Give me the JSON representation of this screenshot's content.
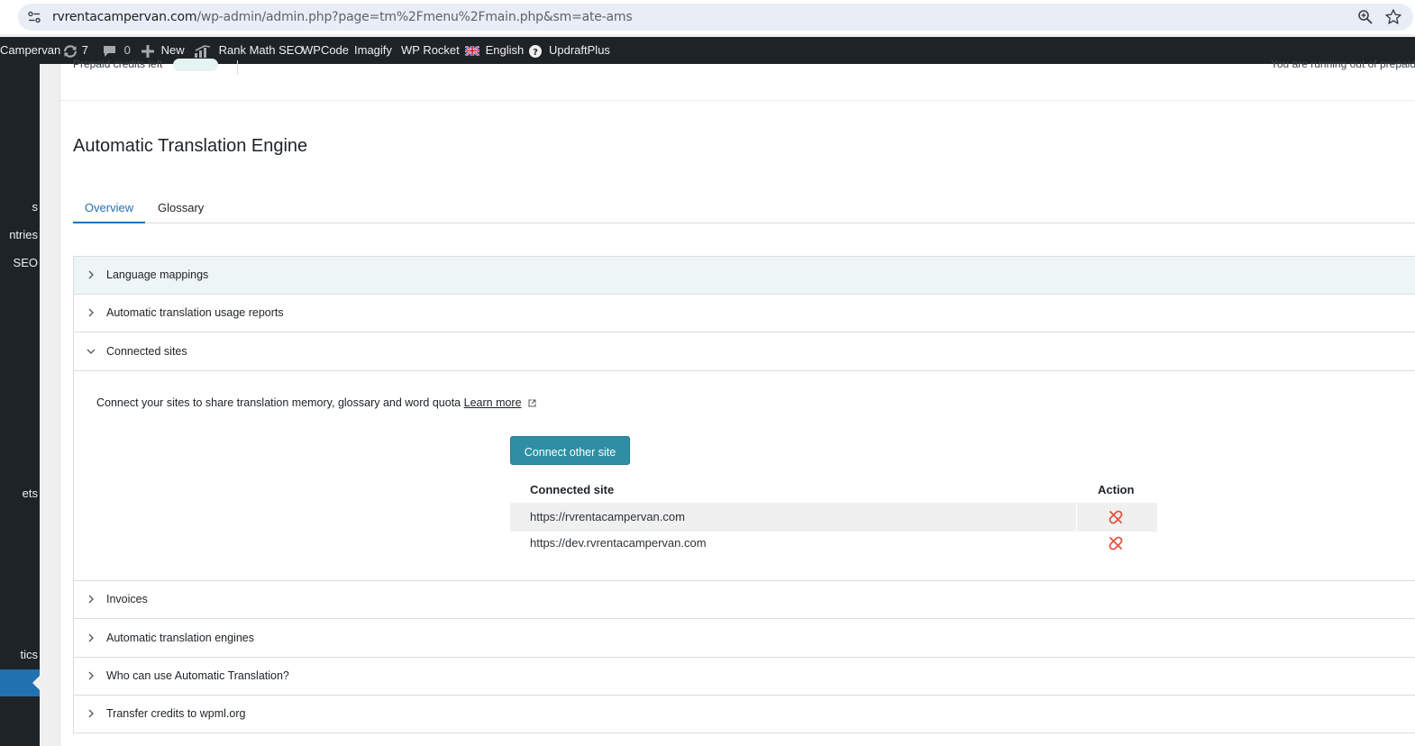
{
  "browser": {
    "url_host": "rvrentacampervan.com",
    "url_path": "/wp-admin/admin.php?page=tm%2Fmenu%2Fmain.php&sm=ate-ams"
  },
  "adminbar": {
    "site_name": "Campervan",
    "updates_count": "7",
    "comments_count": "0",
    "new_label": "New",
    "rank_math": "Rank Math SEO",
    "wpcode": "WPCode",
    "imagify": "Imagify",
    "wp_rocket": "WP Rocket",
    "language": "English",
    "updraft": "UpdraftPlus"
  },
  "sidebar": {
    "items": [
      {
        "label": "s"
      },
      {
        "label": "ntries"
      },
      {
        "label": "SEO"
      },
      {
        "label": "ets"
      },
      {
        "label": "tics"
      }
    ]
  },
  "page": {
    "title": "Automatic Translation Engine",
    "top_fragment_left": "Prepaid credits left",
    "top_fragment_right": "You are running out of prepaid"
  },
  "tabs": [
    {
      "label": "Overview",
      "active": true
    },
    {
      "label": "Glossary",
      "active": false
    }
  ],
  "accordion": [
    {
      "label": "Language mappings",
      "expanded": false
    },
    {
      "label": "Automatic translation usage reports",
      "expanded": false
    },
    {
      "label": "Connected sites",
      "expanded": true
    },
    {
      "label": "Invoices",
      "expanded": false
    },
    {
      "label": "Automatic translation engines",
      "expanded": false
    },
    {
      "label": "Who can use Automatic Translation?",
      "expanded": false
    },
    {
      "label": "Transfer credits to wpml.org",
      "expanded": false
    }
  ],
  "connected_sites": {
    "intro": "Connect your sites to share translation memory, glossary and word quota",
    "learn_more": "Learn more",
    "connect_button": "Connect other site",
    "col_site": "Connected site",
    "col_action": "Action",
    "rows": [
      {
        "site": "https://rvrentacampervan.com"
      },
      {
        "site": "https://dev.rvrentacampervan.com"
      }
    ]
  },
  "colors": {
    "accent": "#2271b1",
    "button": "#2f8ea4",
    "unlink": "#e2533e",
    "adminbar": "#1d2327"
  }
}
